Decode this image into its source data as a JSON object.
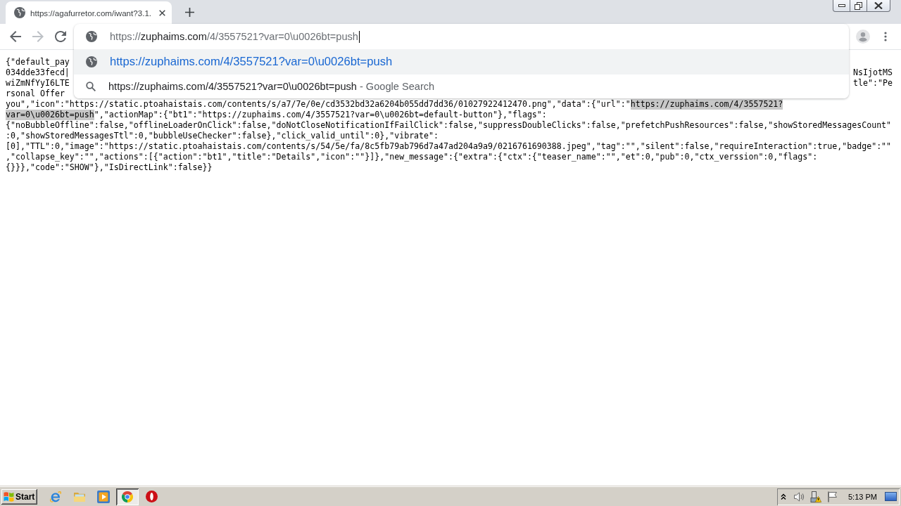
{
  "tabs": [
    {
      "title": "https://agafurretor.com/iwant?3.1.",
      "selected": true
    }
  ],
  "nav": {
    "back_disabled": false,
    "forward_disabled": true
  },
  "omnibox": {
    "scheme": "https://",
    "host": "zuphaims.com",
    "path": "/4/3557521?var=0\\u0026bt=push",
    "focused": true,
    "suggestions": [
      {
        "kind": "url",
        "text": "https://zuphaims.com/4/3557521?var=0\\u0026bt=push",
        "selected": true
      },
      {
        "kind": "search",
        "text": "https://zuphaims.com/4/3557521?var=0\\u0026bt=push",
        "suffix": "- Google Search",
        "selected": false
      }
    ]
  },
  "body": {
    "lines": [
      {
        "parts": [
          {
            "text": "{\"default_pay",
            "selected": false
          }
        ]
      },
      {
        "parts": [
          {
            "text": "034dde33fecd|",
            "selected": false
          }
        ],
        "right": "NsIjotMS"
      },
      {
        "parts": [
          {
            "text": "wiZmNfYyI6LTE",
            "selected": false
          }
        ],
        "right": "tle\":\"Pe"
      },
      {
        "parts": [
          {
            "text": "rsonal Offer",
            "selected": false
          }
        ]
      },
      {
        "parts": [
          {
            "text": "you\",\"icon\":\"https://static.ptoahaistais.com/contents/s/a7/7e/0e/cd3532bd32a6204b055dd7dd36/01027922412470.png\",\"data\":{\"url\":\"",
            "selected": false
          },
          {
            "text": "https://zuphaims.com/4/3557521?",
            "selected": true
          }
        ]
      },
      {
        "parts": [
          {
            "text": "var=0\\u0026bt=push",
            "selected": true
          },
          {
            "text": "\",\"actionMap\":{\"bt1\":\"https://zuphaims.com/4/3557521?var=0\\u0026bt=default-button\"},\"flags\":",
            "selected": false
          }
        ]
      },
      {
        "parts": [
          {
            "text": "{\"noBubbleOffline\":false,\"offlineLoaderOnClick\":false,\"doNotCloseNotificationIfFailClick\":false,\"suppressDoubleClicks\":false,\"prefetchPushResources\":false,\"showStoredMessagesCount\"",
            "selected": false
          }
        ]
      },
      {
        "parts": [
          {
            "text": ":0,\"showStoredMessagesTtl\":0,\"bubbleUseChecker\":false},\"click_valid_until\":0},\"vibrate\":",
            "selected": false
          }
        ]
      },
      {
        "parts": [
          {
            "text": "[0],\"TTL\":0,\"image\":\"https://static.ptoahaistais.com/contents/s/54/5e/fa/8c5fb79ab796d7a47ad204a9a9/0216761690388.jpeg\",\"tag\":\"\",\"silent\":false,\"requireInteraction\":true,\"badge\":\"\"",
            "selected": false
          }
        ]
      },
      {
        "parts": [
          {
            "text": ",\"collapse_key\":\"\",\"actions\":[{\"action\":\"bt1\",\"title\":\"Details\",\"icon\":\"\"}]},\"new_message\":{\"extra\":{\"ctx\":{\"teaser_name\":\"\",\"et\":0,\"pub\":0,\"ctx_verssion\":0,\"flags\":",
            "selected": false
          }
        ]
      },
      {
        "parts": [
          {
            "text": "{}}},\"code\":\"SHOW\"},\"IsDirectLink\":false}}",
            "selected": false
          }
        ]
      }
    ]
  },
  "taskbar": {
    "start": "Start",
    "apps": [
      {
        "kind": "browser_e",
        "selected": false
      },
      {
        "kind": "folder",
        "selected": false
      },
      {
        "kind": "media_player",
        "selected": false
      },
      {
        "kind": "browser_circle",
        "selected": true
      },
      {
        "kind": "browser_o",
        "selected": false
      }
    ],
    "clock": "5:13 PM"
  }
}
